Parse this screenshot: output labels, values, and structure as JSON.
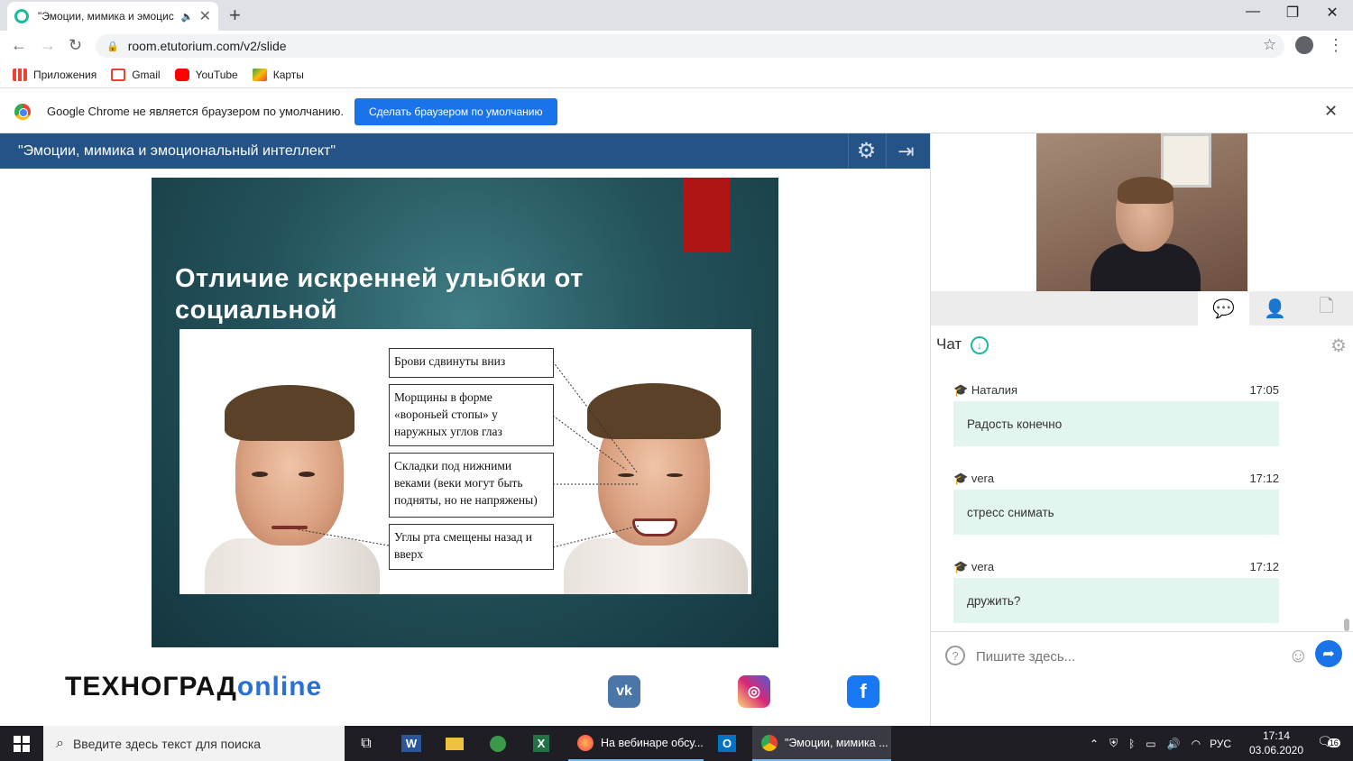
{
  "browser": {
    "tab_title": "\"Эмоции, мимика и эмоцис",
    "url": "room.etutorium.com/v2/slide",
    "bookmarks": [
      "Приложения",
      "Gmail",
      "YouTube",
      "Карты"
    ],
    "infobar_text": "Google Chrome не является браузером по умолчанию.",
    "infobar_button": "Сделать браузером по умолчанию"
  },
  "header": {
    "title": "\"Эмоции, мимика и эмоциональный интеллект\""
  },
  "slide": {
    "title": "Отличие искренней улыбки от социальной",
    "labels": [
      "Брови сдвинуты вниз",
      "Морщины в форме «вороньей стопы» у наружных углов глаз",
      "Складки под нижними веками (веки могут быть подняты, но не напряжены)",
      "Углы рта смещены назад и вверх"
    ]
  },
  "footer": {
    "logo_main": "ТЕХНОГРАД",
    "logo_online": "online",
    "socials": [
      "vk-icon",
      "instagram-icon",
      "facebook-icon"
    ]
  },
  "chat": {
    "title": "Чат",
    "messages": [
      {
        "author": "Наталия",
        "time": "17:05",
        "text": "Радость конечно"
      },
      {
        "author": "vera",
        "time": "17:12",
        "text": "стресс снимать"
      },
      {
        "author": "vera",
        "time": "17:12",
        "text": "дружить?"
      }
    ],
    "input_placeholder": "Пишите здесь..."
  },
  "taskbar": {
    "search_placeholder": "Введите здесь текст для поиска",
    "apps": [
      {
        "name": "firefox",
        "label": "На вебинаре обсу..."
      },
      {
        "name": "chrome",
        "label": "\"Эмоции, мимика ..."
      }
    ],
    "lang": "РУС",
    "time": "17:14",
    "date": "03.06.2020",
    "notifications": "16"
  },
  "colors": {
    "header_bg": "#245388",
    "accent": "#1a73e8",
    "chat_bubble": "#e2f5ee",
    "slide_red": "#b01515"
  }
}
